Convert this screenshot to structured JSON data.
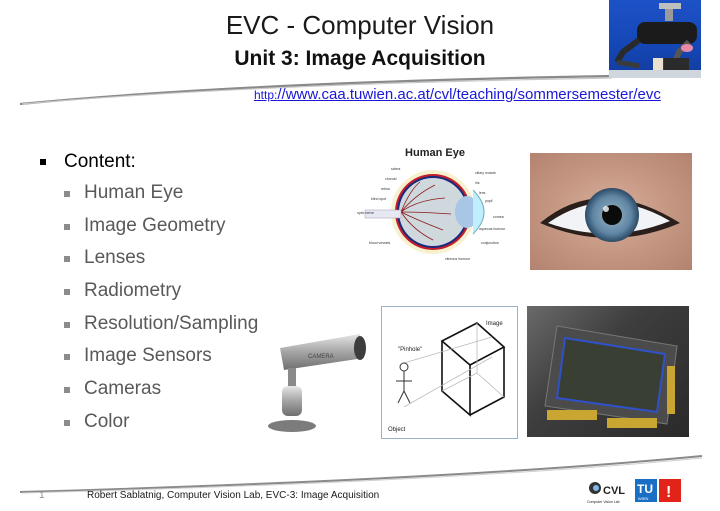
{
  "slide": {
    "title": "EVC - Computer Vision",
    "subtitle": "Unit 3: Image Acquisition",
    "url": {
      "prefix": "http:",
      "rest": "//www.caa.tuwien.ac.at/cvl/teaching/sommersemester/evc"
    },
    "content": {
      "heading": "Content:",
      "items": [
        {
          "label": "Human Eye"
        },
        {
          "label": "Image Geometry"
        },
        {
          "label": "Lenses"
        },
        {
          "label": "Radiometry"
        },
        {
          "label": "Resolution/Sampling"
        },
        {
          "label": "Image Sensors"
        },
        {
          "label": "Cameras"
        },
        {
          "label": "Color"
        }
      ]
    },
    "images": {
      "robot": "robot-photo",
      "eye_diagram": {
        "title": "Human Eye",
        "labels": [
          "sclera",
          "choroid",
          "retina",
          "blind spot",
          "optic nerve",
          "blood vessels",
          "ciliary muscle",
          "iris",
          "lens",
          "pupil",
          "cornea",
          "aqueous humour",
          "conjunctiva",
          "vitreous humour"
        ]
      },
      "eye_photo": "eye-photo",
      "pinhole": {
        "label_pinhole": "\"Pinhole\"",
        "label_image": "Image",
        "label_object": "Object"
      },
      "sensor": "image-sensor-photo",
      "camera": {
        "label": "CAMERA"
      }
    },
    "footer": {
      "page_number": "1",
      "text": "Robert Sablatnig, Computer Vision Lab, EVC-3: Image Acquisition",
      "logos": {
        "cvl": "CVL",
        "cvl_sub": "Computer Vision Lab",
        "tu": "TU",
        "wien": "WIEN",
        "exclaim": "!"
      }
    },
    "colors": {
      "link": "#1a18d8",
      "tu_blue": "#1a6fc4",
      "tu_red": "#e2231a"
    }
  }
}
